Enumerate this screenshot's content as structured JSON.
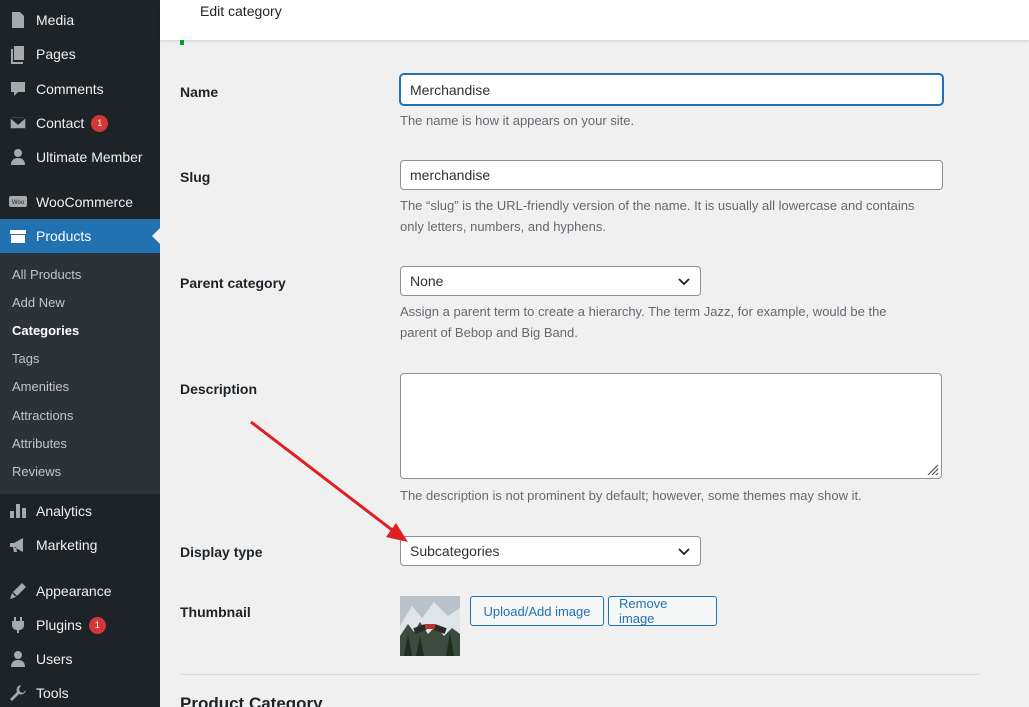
{
  "sidebar": {
    "menu": [
      {
        "label": "Media",
        "icon": "media-icon"
      },
      {
        "label": "Pages",
        "icon": "pages-icon"
      },
      {
        "label": "Comments",
        "icon": "comments-icon"
      },
      {
        "label": "Contact",
        "icon": "mail-icon",
        "badge": "1"
      },
      {
        "label": "Ultimate Member",
        "icon": "user-icon"
      },
      {
        "label": "WooCommerce",
        "icon": "woocommerce-icon"
      },
      {
        "label": "Products",
        "icon": "products-icon",
        "active": true
      },
      {
        "label": "Analytics",
        "icon": "analytics-icon"
      },
      {
        "label": "Marketing",
        "icon": "megaphone-icon"
      },
      {
        "label": "Appearance",
        "icon": "appearance-icon"
      },
      {
        "label": "Plugins",
        "icon": "plugins-icon",
        "badge": "1"
      },
      {
        "label": "Users",
        "icon": "users-icon"
      },
      {
        "label": "Tools",
        "icon": "tools-icon"
      }
    ],
    "submenu": [
      {
        "label": "All Products"
      },
      {
        "label": "Add New"
      },
      {
        "label": "Categories",
        "current": true
      },
      {
        "label": "Tags"
      },
      {
        "label": "Amenities"
      },
      {
        "label": "Attractions"
      },
      {
        "label": "Attributes"
      },
      {
        "label": "Reviews"
      }
    ]
  },
  "header": {
    "title": "Edit category"
  },
  "form": {
    "name": {
      "label": "Name",
      "value": "Merchandise",
      "help": "The name is how it appears on your site."
    },
    "slug": {
      "label": "Slug",
      "value": "merchandise",
      "help_line1": "The “slug” is the URL-friendly version of the name. It is usually all lowercase and contains",
      "help_line2": "only letters, numbers, and hyphens."
    },
    "parent": {
      "label": "Parent category",
      "value": "None",
      "help_line1": "Assign a parent term to create a hierarchy. The term Jazz, for example, would be the",
      "help_line2": "parent of Bebop and Big Band."
    },
    "description": {
      "label": "Description",
      "value": "",
      "help": "The description is not prominent by default; however, some themes may show it."
    },
    "display_type": {
      "label": "Display type",
      "value": "Subcategories"
    },
    "thumbnail": {
      "label": "Thumbnail",
      "upload_label": "Upload/Add image",
      "remove_label": "Remove image"
    }
  },
  "section": {
    "heading": "Product Category"
  },
  "colors": {
    "sidebar_bg": "#1d2327",
    "active_bg": "#2271b1",
    "badge": "#d63638",
    "annotation_arrow": "#e02020"
  }
}
